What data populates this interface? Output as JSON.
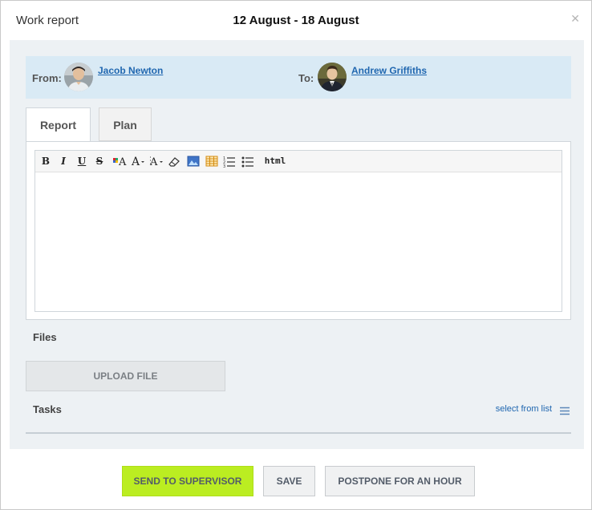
{
  "dialog": {
    "title": "Work report",
    "period": "12 August - 18 August",
    "close_icon": "close-icon"
  },
  "people": {
    "from_label": "From:",
    "from_name": "Jacob Newton",
    "to_label": "To:",
    "to_name": "Andrew Griffiths"
  },
  "tabs": [
    {
      "label": "Report",
      "active": true
    },
    {
      "label": "Plan",
      "active": false
    }
  ],
  "editor": {
    "toolbar": [
      "bold-icon",
      "italic-icon",
      "underline-icon",
      "strikethrough-icon",
      "text-color-icon",
      "font-size-icon",
      "font-family-icon",
      "eraser-icon",
      "image-icon",
      "table-icon",
      "ordered-list-icon",
      "unordered-list-icon"
    ],
    "html_label": "html",
    "content": ""
  },
  "files": {
    "label": "Files",
    "upload_label": "UPLOAD FILE"
  },
  "tasks": {
    "label": "Tasks",
    "select_link": "select from list"
  },
  "footer": {
    "send_label": "SEND TO SUPERVISOR",
    "save_label": "SAVE",
    "postpone_label": "POSTPONE FOR AN HOUR"
  },
  "colors": {
    "accent_green": "#bbed21",
    "link_blue": "#2067b0",
    "people_bg": "#d9eaf5",
    "body_bg": "#edf1f4"
  }
}
